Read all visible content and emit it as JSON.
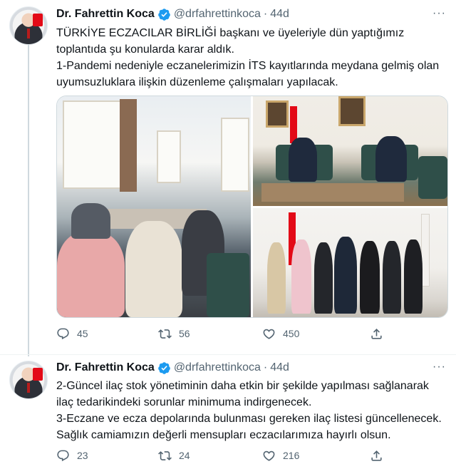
{
  "tweets": [
    {
      "author": "Dr. Fahrettin Koca",
      "handle": "@drfahrettinkoca",
      "separator": "·",
      "time": "44d",
      "more": "···",
      "lines": [
        "TÜRKİYE ECZACILAR BİRLİĞİ başkanı ve üyeleriyle dün yaptığımız",
        "toplantıda şu konularda karar aldık.",
        "1-Pandemi nedeniyle eczanelerimizin İTS kayıtlarında meydana gelmiş olan",
        "uyumsuzluklara ilişkin düzenleme çalışmaları yapılacak."
      ],
      "replies": "45",
      "retweets": "56",
      "likes": "450"
    },
    {
      "author": "Dr. Fahrettin Koca",
      "handle": "@drfahrettinkoca",
      "separator": "·",
      "time": "44d",
      "more": "···",
      "lines": [
        "2-Güncel ilaç stok yönetiminin daha etkin bir şekilde yapılması sağlanarak",
        "ilaç tedarikindeki sorunlar minimuma indirgenecek.",
        "3-Eczane ve ecza depolarında bulunması gereken ilaç listesi güncellenecek.",
        "Sağlık camiamızın değerli mensupları eczacılarımıza hayırlı olsun."
      ],
      "replies": "23",
      "retweets": "24",
      "likes": "216"
    }
  ],
  "icons": {
    "verified": "verified-badge-icon",
    "reply": "reply-icon",
    "retweet": "retweet-icon",
    "like": "heart-icon",
    "share": "share-icon"
  },
  "colors": {
    "verified": "#1d9bf0",
    "secondary_text": "#536471",
    "thread_line": "#cfd9de"
  }
}
